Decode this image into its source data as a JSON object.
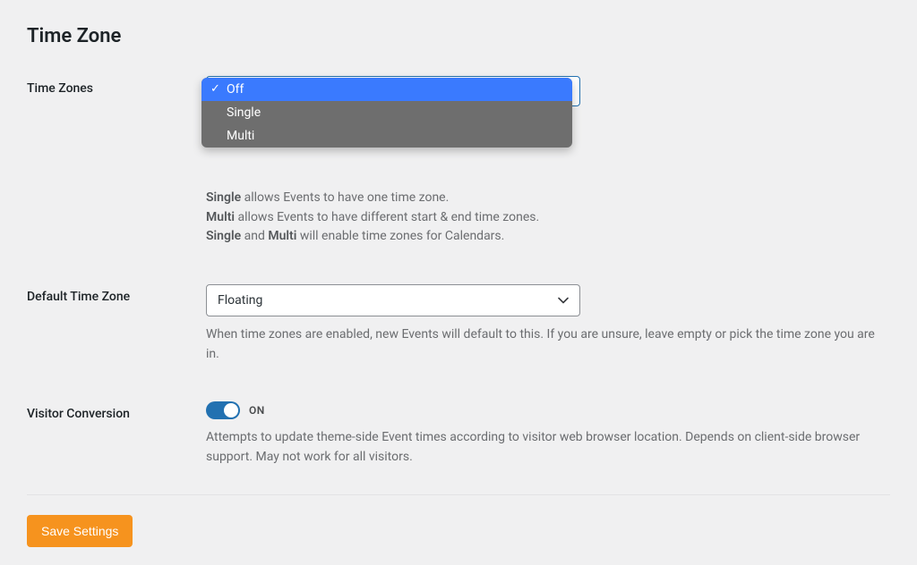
{
  "heading": "Time Zone",
  "time_zones": {
    "label": "Time Zones",
    "options": [
      "Off",
      "Single",
      "Multi"
    ],
    "selected": "Off",
    "desc_line1_b": "Single",
    "desc_line1_rest": " allows Events to have one time zone.",
    "desc_line2_b": "Multi",
    "desc_line2_rest": " allows Events to have different start & end time zones.",
    "desc_line3_b1": "Single",
    "desc_line3_mid": " and ",
    "desc_line3_b2": "Multi",
    "desc_line3_rest": " will enable time zones for Calendars."
  },
  "default_tz": {
    "label": "Default Time Zone",
    "value": "Floating",
    "desc": "When time zones are enabled, new Events will default to this. If you are unsure, leave empty or pick the time zone you are in."
  },
  "visitor": {
    "label": "Visitor Conversion",
    "state_text": "ON",
    "desc": "Attempts to update theme-side Event times according to visitor web browser location. Depends on client-side browser support. May not work for all visitors."
  },
  "save_button": "Save Settings"
}
